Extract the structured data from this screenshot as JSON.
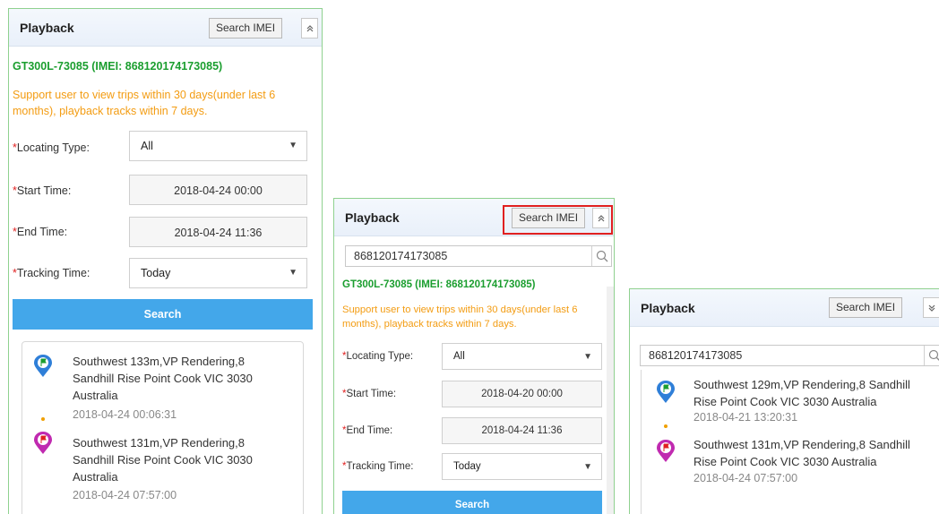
{
  "panel_title": "Playback",
  "search_imei_label": "Search IMEI",
  "collapse_glyph": "≈",
  "expand_glyph": "¥",
  "device_line": "GT300L-73085 (IMEI: 868120174173085)",
  "notice": "Support user to view trips within 30 days(under last 6 months), playback tracks within 7 days.",
  "imei_query": "868120174173085",
  "labels": {
    "required_mark": "*",
    "locating_type": "Locating Type:",
    "start_time": "Start Time:",
    "end_time": "End Time:",
    "tracking_time": "Tracking Time:"
  },
  "search_label": "Search",
  "panel1": {
    "locating_type": "All",
    "start_time": "2018-04-24 00:00",
    "end_time": "2018-04-24 11:36",
    "tracking_time": "Today",
    "results": [
      {
        "address_l1": "Southwest 133m,VP Rendering,8",
        "address_l2": "Sandhill Rise Point Cook VIC 3030",
        "address_l3": "Australia",
        "time": "2018-04-24 00:06:31",
        "icon": "start-flag-pin-icon"
      },
      {
        "address_l1": "Southwest 131m,VP Rendering,8",
        "address_l2": "Sandhill Rise Point Cook VIC 3030",
        "address_l3": "Australia",
        "time": "2018-04-24 07:57:00",
        "icon": "end-flag-pin-icon"
      }
    ]
  },
  "panel2": {
    "locating_type": "All",
    "start_time": "2018-04-20 00:00",
    "end_time": "2018-04-24 11:36",
    "tracking_time": "Today"
  },
  "panel3": {
    "results": [
      {
        "address_l1": "Southwest 129m,VP Rendering,8 Sandhill",
        "address_l2": "Rise Point Cook VIC 3030 Australia",
        "time": "2018-04-21 13:20:31",
        "icon": "start-flag-pin-icon"
      },
      {
        "address_l1": "Southwest 131m,VP Rendering,8 Sandhill",
        "address_l2": "Rise Point Cook VIC 3030 Australia",
        "time": "2018-04-24 07:57:00",
        "icon": "end-flag-pin-icon"
      }
    ]
  },
  "colors": {
    "panel_border": "#8fd18f",
    "device_green": "#1b9e2f",
    "notice_orange": "#f39c12",
    "search_blue": "#43a7ea",
    "highlight_red": "#e02020",
    "start_pin_blue": "#2f7fd8",
    "end_pin_magenta": "#c02ab0"
  }
}
